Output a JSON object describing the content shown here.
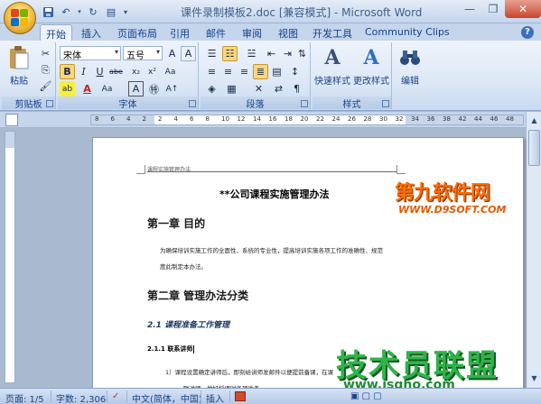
{
  "window": {
    "title": "课件录制模板2.doc [兼容模式] - Microsoft Word"
  },
  "tabs": [
    "开始",
    "插入",
    "页面布局",
    "引用",
    "邮件",
    "审阅",
    "视图",
    "开发工具",
    "Community Clips"
  ],
  "ribbon": {
    "clipboard": {
      "paste_label": "粘贴",
      "group_label": "剪贴板"
    },
    "font": {
      "font_name": "宋体",
      "font_size": "五号",
      "group_label": "字体"
    },
    "paragraph": {
      "group_label": "段落"
    },
    "styles": {
      "quick_styles_label": "快速样式",
      "change_styles_label": "更改样式",
      "group_label": "样式"
    },
    "editing": {
      "edit_label": "编辑"
    }
  },
  "ruler": {
    "numbers": [
      "8",
      "6",
      "4",
      "2",
      "2",
      "4",
      "6",
      "8",
      "10",
      "12",
      "14",
      "16",
      "18",
      "20",
      "22",
      "24",
      "26",
      "28",
      "30",
      "32",
      "34",
      "36",
      "38",
      "42",
      "44",
      "46",
      "48"
    ]
  },
  "document": {
    "header_text": "课程实施管理办法",
    "title": "**公司课程实施管理办法",
    "chapter1": "第一章  目的",
    "para1_line1": "为确保培训实施工作的全面性、系统的专业性，提高培训实施各项工作的准确性、规范",
    "para1_line2": "度此制定本办法。",
    "chapter2": "第二章  管理办法分类",
    "section21": "2.1 课程准备工作管理",
    "section211": "2.1.1   联系讲师",
    "para2_line1": "1）课程设置确定讲师后，即刻给讲师发邮件以便提前备课，在课",
    "para2_line2": "联讲师，做好授课时各项准备。"
  },
  "watermarks": {
    "wm1": "第九软件网",
    "wm1_url": "WWW.D9SOFT.COM",
    "wm2": "技术员联盟",
    "wm2_url": "www.jsgho.com"
  },
  "statusbar": {
    "page": "页面: 1/5",
    "words": "字数: 2,306",
    "language": "中文(简体，中国)",
    "mode": "插入"
  },
  "colors": {
    "ribbon_bg": "#dde8f6",
    "accent": "#15428b",
    "watermark_orange": "#ff6a00",
    "watermark_green": "#2fb34a"
  }
}
